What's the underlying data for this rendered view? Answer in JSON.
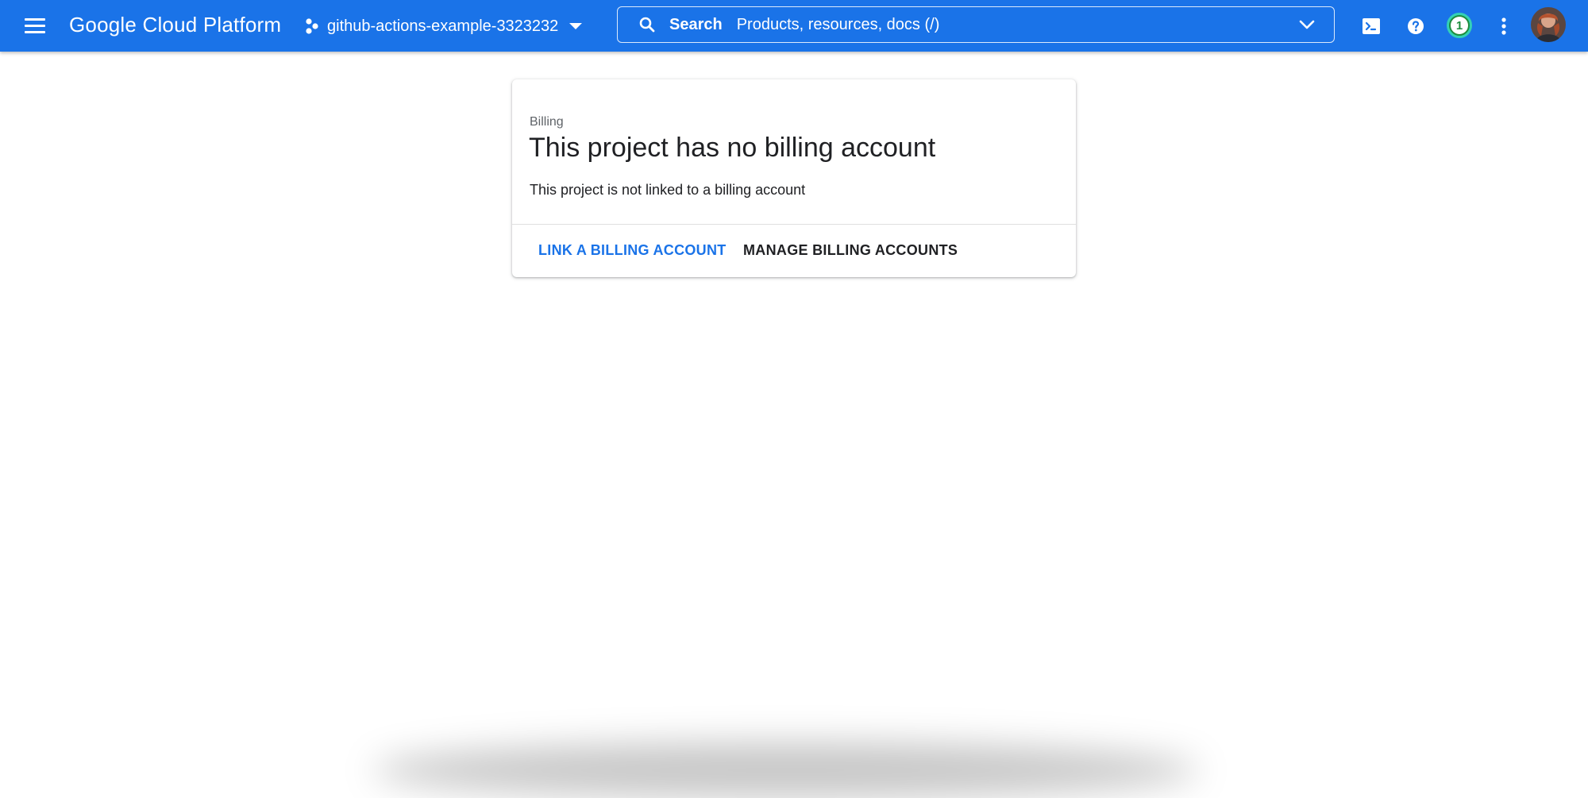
{
  "topbar": {
    "app_title": "Google Cloud Platform",
    "project_name": "github-actions-example-3323232",
    "search": {
      "label": "Search",
      "placeholder": "Products, resources, docs (/)"
    },
    "notification_count": "1",
    "icons": {
      "menu": "hamburger-menu-icon",
      "project": "project-hexagon-icon",
      "project_dropdown": "caret-down-icon",
      "search": "magnifier-icon",
      "search_expand": "chevron-down-icon",
      "cloud_shell": "terminal-icon",
      "help": "help-icon",
      "more": "more-vert-icon"
    },
    "colors": {
      "bar": "#1a73e8",
      "badge_ring": "#34d1b6",
      "badge_fill": "#1e8e3e"
    }
  },
  "card": {
    "eyebrow": "Billing",
    "heading": "This project has no billing account",
    "description": "This project is not linked to a billing account",
    "buttons": {
      "link": "LINK A BILLING ACCOUNT",
      "manage": "MANAGE BILLING ACCOUNTS"
    },
    "colors": {
      "link_button": "#1a73e8"
    }
  }
}
